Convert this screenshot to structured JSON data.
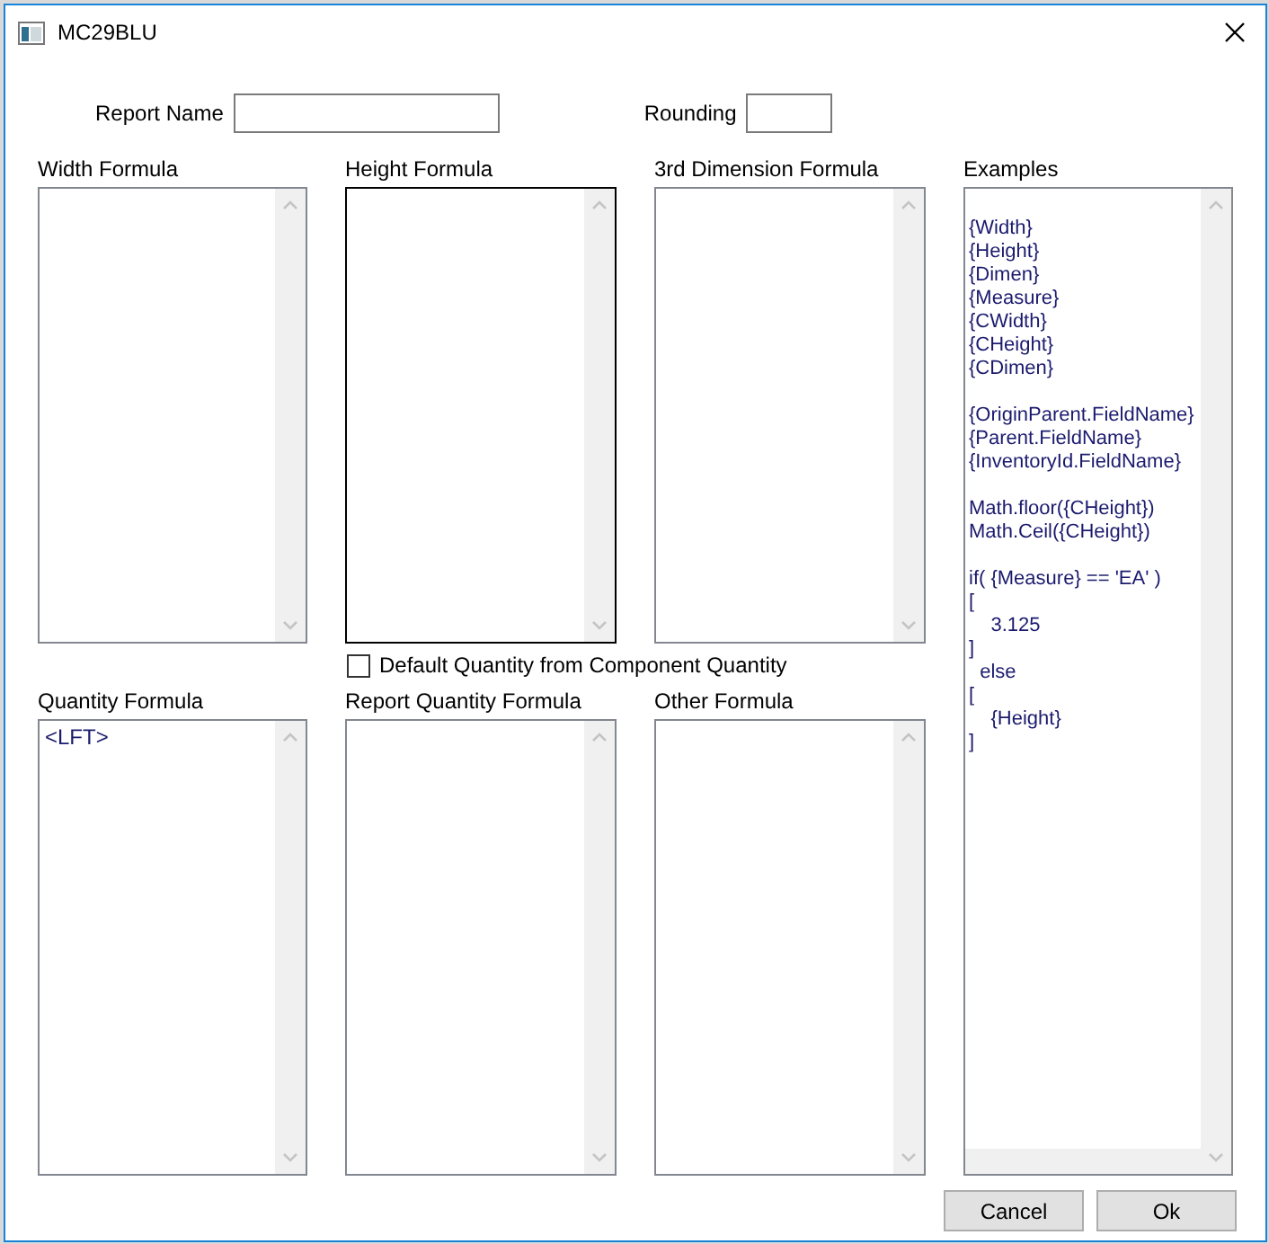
{
  "window": {
    "title": "MC29BLU"
  },
  "report_name": {
    "label": "Report Name"
  },
  "rounding": {
    "label": "Rounding"
  },
  "formulas_top": [
    {
      "label": "Width Formula",
      "focused": false
    },
    {
      "label": "Height Formula",
      "focused": true
    },
    {
      "label": "3rd Dimension Formula",
      "focused": false
    }
  ],
  "default_quantity_checkbox": {
    "label": "Default Quantity from Component Quantity",
    "checked": false
  },
  "formulas_bottom": [
    {
      "label": "Quantity Formula",
      "value": "<LFT>",
      "focused": false
    },
    {
      "label": "Report Quantity Formula",
      "focused": false
    },
    {
      "label": "Other Formula",
      "focused": false
    }
  ],
  "examples": {
    "label": "Examples",
    "blocks": [
      [
        "{Width}",
        "{Height}",
        "{Dimen}",
        "{Measure}",
        "{CWidth}",
        "{CHeight}",
        "{CDimen}"
      ],
      [
        "{OriginParent.FieldName}",
        "{Parent.FieldName}",
        "{InventoryId.FieldName}"
      ],
      [
        "Math.floor({CHeight})",
        "Math.Ceil({CHeight})"
      ],
      [
        "if( {Measure} == 'EA' )",
        "[",
        "    3.125",
        "]",
        "  else",
        "[",
        "    {Height}",
        "]"
      ]
    ]
  },
  "buttons": [
    "Cancel",
    "Ok"
  ]
}
